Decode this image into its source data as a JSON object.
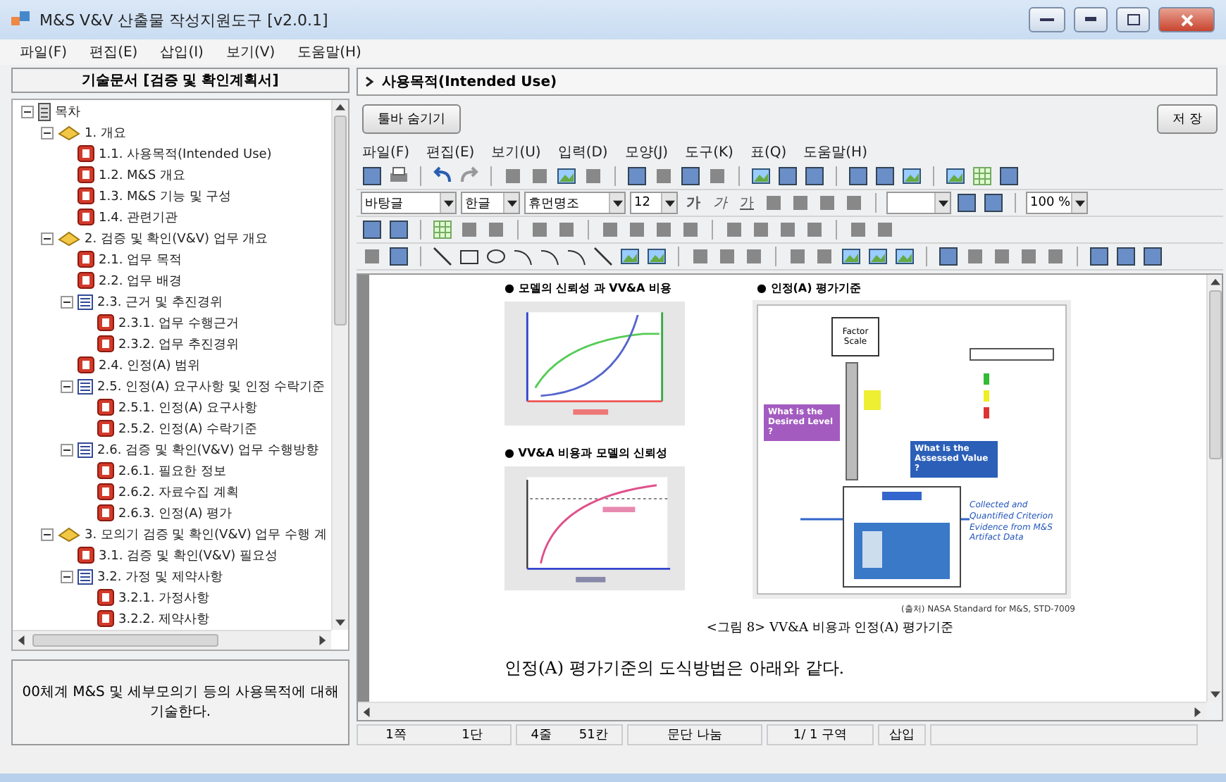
{
  "window": {
    "title": "M&S V&V 산출물 작성지원도구 [v2.0.1]"
  },
  "menu": [
    "파일(F)",
    "편집(E)",
    "삽입(I)",
    "보기(V)",
    "도움말(H)"
  ],
  "left_panel": {
    "header": "기술문서 [검증 및 확인계획서]",
    "tree": [
      {
        "label": "목차",
        "kind": "root",
        "expanded": true,
        "children": [
          {
            "label": "1. 개요",
            "kind": "book",
            "expanded": true,
            "children": [
              {
                "label": "1.1. 사용목적(Intended Use)",
                "kind": "page"
              },
              {
                "label": "1.2. M&S 개요",
                "kind": "page"
              },
              {
                "label": "1.3. M&S 기능 및 구성",
                "kind": "page"
              },
              {
                "label": "1.4. 관련기관",
                "kind": "page"
              }
            ]
          },
          {
            "label": "2. 검증 및 확인(V&V) 업무 개요",
            "kind": "book",
            "expanded": true,
            "children": [
              {
                "label": "2.1. 업무 목적",
                "kind": "page"
              },
              {
                "label": "2.2. 업무 배경",
                "kind": "page"
              },
              {
                "label": "2.3. 근거 및 추진경위",
                "kind": "list",
                "expanded": true,
                "children": [
                  {
                    "label": "2.3.1. 업무 수행근거",
                    "kind": "page"
                  },
                  {
                    "label": "2.3.2. 업무 추진경위",
                    "kind": "page"
                  }
                ]
              },
              {
                "label": "2.4. 인정(A) 범위",
                "kind": "page"
              },
              {
                "label": "2.5. 인정(A) 요구사항 및 인정 수락기준",
                "kind": "list",
                "expanded": true,
                "children": [
                  {
                    "label": "2.5.1. 인정(A) 요구사항",
                    "kind": "page"
                  },
                  {
                    "label": "2.5.2. 인정(A) 수락기준",
                    "kind": "page"
                  }
                ]
              },
              {
                "label": "2.6. 검증 및 확인(V&V) 업무 수행방향",
                "kind": "list",
                "expanded": true,
                "children": [
                  {
                    "label": "2.6.1. 필요한 정보",
                    "kind": "page"
                  },
                  {
                    "label": "2.6.2. 자료수집 계획",
                    "kind": "page"
                  },
                  {
                    "label": "2.6.3. 인정(A) 평가",
                    "kind": "page"
                  }
                ]
              }
            ]
          },
          {
            "label": "3. 모의기 검증 및 확인(V&V) 업무 수행 계",
            "kind": "book",
            "expanded": true,
            "children": [
              {
                "label": "3.1. 검증 및 확인(V&V) 필요성",
                "kind": "page"
              },
              {
                "label": "3.2. 가정 및 제약사항",
                "kind": "list",
                "expanded": true,
                "children": [
                  {
                    "label": "3.2.1. 가정사항",
                    "kind": "page"
                  },
                  {
                    "label": "3.2.2. 제약사항",
                    "kind": "page"
                  }
                ]
              }
            ]
          }
        ]
      }
    ],
    "description": "00체계 M&S 및 세부모의기 등의 사용목적에 대해 기술한다."
  },
  "editor": {
    "breadcrumb": "사용목적(Intended Use)",
    "buttons": {
      "hide_toolbar": "툴바 숨기기",
      "save": "저 장"
    },
    "menu": [
      "파일(F)",
      "편집(E)",
      "보기(U)",
      "입력(D)",
      "모양(J)",
      "도구(K)",
      "표(Q)",
      "도움말(H)"
    ],
    "format_bar": {
      "style": "바탕글",
      "language": "한글",
      "font": "휴먼명조",
      "size": "12",
      "zoom": "100 %",
      "char_buttons": [
        {
          "label": "가",
          "kind": "bold"
        },
        {
          "label": "가",
          "kind": "italic"
        },
        {
          "label": "가",
          "kind": "underline"
        }
      ]
    },
    "document": {
      "figures": [
        {
          "heading": "● 모델의 신뢰성 과 VV&A 비용",
          "kind": "cost"
        },
        {
          "heading": "● VV&A 비용과 모델의 신뢰성",
          "kind": "credibility"
        }
      ],
      "diagram": {
        "heading": "● 인정(A) 평가기준",
        "factor_scale": "Factor Scale",
        "desired": "What is the Desired Level ?",
        "assessed": "What is the Assessed Value ?",
        "evidence": "Collected and Quantified Criterion Evidence from M&S Artifact Data"
      },
      "source": "(출처) NASA Standard for M&S, STD-7009",
      "caption": "<그림 8> VV&A 비용과 인정(A) 평가기준",
      "paragraph": "인정(A) 평가기준의 도식방법은 아래와 같다."
    }
  },
  "status_bar": [
    "1쪽",
    "1단",
    "4줄",
    "51칸",
    "문단 나눔",
    "1/  1 구역",
    "삽입"
  ]
}
